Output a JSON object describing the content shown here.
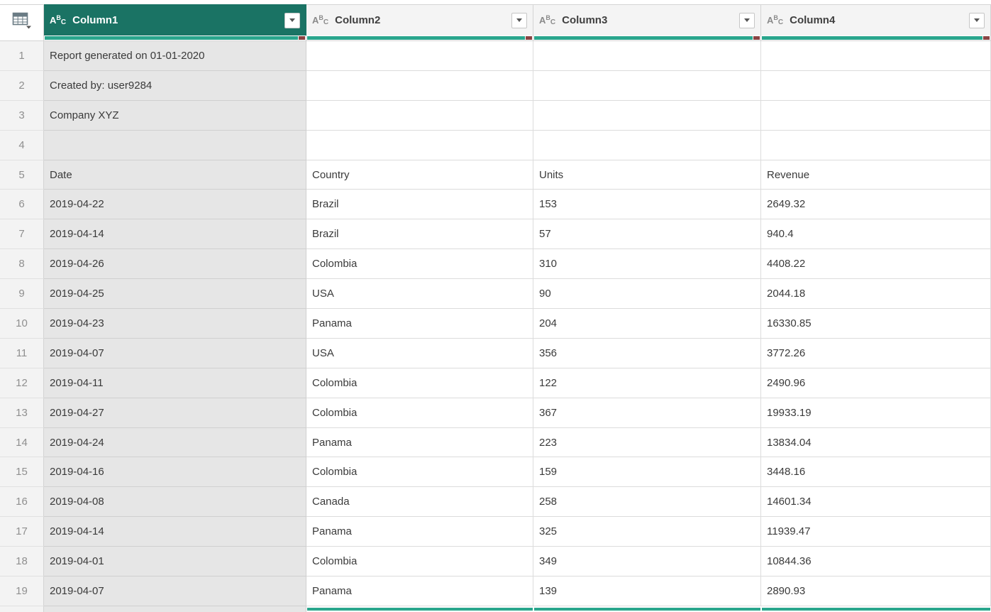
{
  "app": {
    "name": "Power Query data preview"
  },
  "colors": {
    "header_selected_bg": "#1a7364",
    "header_bg": "#f4f4f4",
    "quality_bar": "#2aa68d",
    "quality_error": "#8a4343",
    "selected_column_cell_bg": "#e6e6e6"
  },
  "grid": {
    "type_icon_letters": [
      "A",
      "B",
      "C"
    ],
    "columns": [
      {
        "label": "Column1",
        "type": "ABC",
        "selected": true
      },
      {
        "label": "Column2",
        "type": "ABC",
        "selected": false
      },
      {
        "label": "Column3",
        "type": "ABC",
        "selected": false
      },
      {
        "label": "Column4",
        "type": "ABC",
        "selected": false
      }
    ],
    "rows": [
      {
        "num": "1",
        "cells": [
          "Report generated on 01-01-2020",
          "",
          "",
          ""
        ]
      },
      {
        "num": "2",
        "cells": [
          "Created by: user9284",
          "",
          "",
          ""
        ]
      },
      {
        "num": "3",
        "cells": [
          "Company XYZ",
          "",
          "",
          ""
        ]
      },
      {
        "num": "4",
        "cells": [
          "",
          "",
          "",
          ""
        ]
      },
      {
        "num": "5",
        "cells": [
          "Date",
          "Country",
          "Units",
          "Revenue"
        ]
      },
      {
        "num": "6",
        "cells": [
          "2019-04-22",
          "Brazil",
          "153",
          "2649.32"
        ]
      },
      {
        "num": "7",
        "cells": [
          "2019-04-14",
          "Brazil",
          "57",
          "940.4"
        ]
      },
      {
        "num": "8",
        "cells": [
          "2019-04-26",
          "Colombia",
          "310",
          "4408.22"
        ]
      },
      {
        "num": "9",
        "cells": [
          "2019-04-25",
          "USA",
          "90",
          "2044.18"
        ]
      },
      {
        "num": "10",
        "cells": [
          "2019-04-23",
          "Panama",
          "204",
          "16330.85"
        ]
      },
      {
        "num": "11",
        "cells": [
          "2019-04-07",
          "USA",
          "356",
          "3772.26"
        ]
      },
      {
        "num": "12",
        "cells": [
          "2019-04-11",
          "Colombia",
          "122",
          "2490.96"
        ]
      },
      {
        "num": "13",
        "cells": [
          "2019-04-27",
          "Colombia",
          "367",
          "19933.19"
        ]
      },
      {
        "num": "14",
        "cells": [
          "2019-04-24",
          "Panama",
          "223",
          "13834.04"
        ]
      },
      {
        "num": "15",
        "cells": [
          "2019-04-16",
          "Colombia",
          "159",
          "3448.16"
        ]
      },
      {
        "num": "16",
        "cells": [
          "2019-04-08",
          "Canada",
          "258",
          "14601.34"
        ]
      },
      {
        "num": "17",
        "cells": [
          "2019-04-14",
          "Panama",
          "325",
          "11939.47"
        ]
      },
      {
        "num": "18",
        "cells": [
          "2019-04-01",
          "Colombia",
          "349",
          "10844.36"
        ]
      },
      {
        "num": "19",
        "cells": [
          "2019-04-07",
          "Panama",
          "139",
          "2890.93"
        ]
      }
    ]
  }
}
